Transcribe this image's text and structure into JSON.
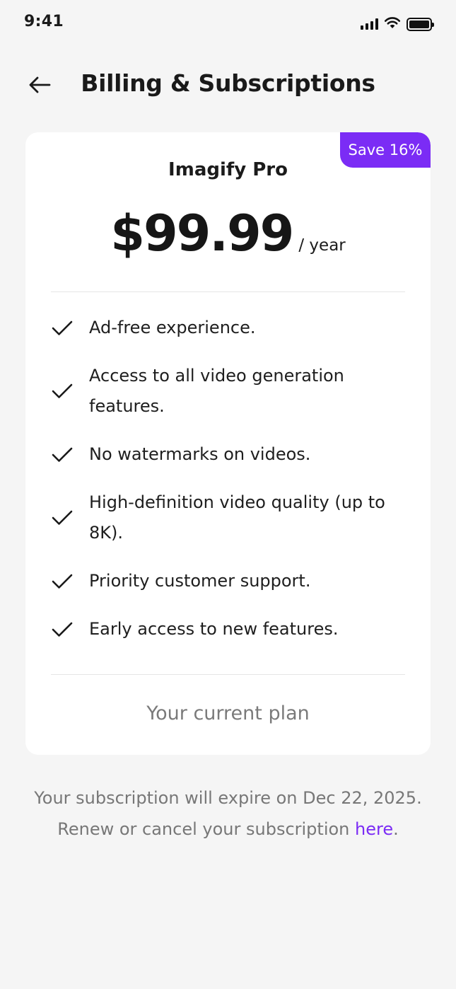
{
  "status_bar": {
    "time": "9:41"
  },
  "header": {
    "title": "Billing & Subscriptions"
  },
  "plan": {
    "badge": "Save 16%",
    "name": "Imagify Pro",
    "price": "$99.99",
    "period": "/ year",
    "features": [
      "Ad-free experience.",
      "Access to all video generation features.",
      "No watermarks on videos.",
      "High-definition video quality (up to 8K).",
      "Priority customer support.",
      "Early access to new features."
    ],
    "status": "Your current plan"
  },
  "footer": {
    "expiry_text": "Your subscription will expire on Dec 22, 2025.",
    "renew_text": "Renew or cancel your subscription ",
    "link_text": "here",
    "trailing": "."
  },
  "colors": {
    "accent": "#7b2cf5",
    "background": "#f5f5f5",
    "card": "#ffffff"
  }
}
